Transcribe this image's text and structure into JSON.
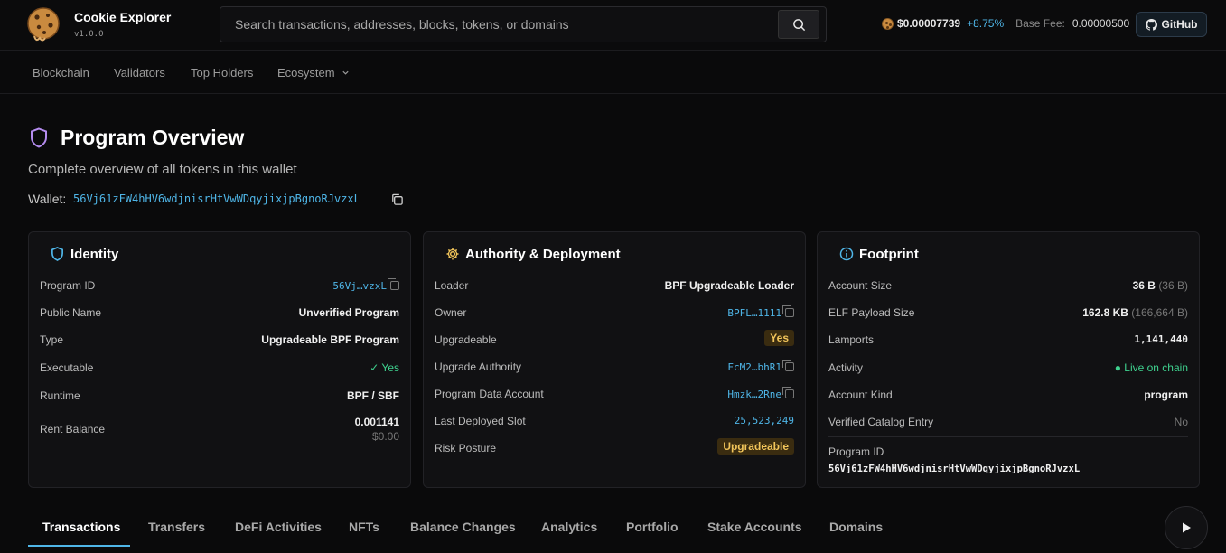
{
  "app": {
    "name": "Cookie Explorer",
    "version": "v1.0.0"
  },
  "search": {
    "placeholder": "Search transactions, addresses, blocks, tokens, or domains"
  },
  "header": {
    "price": "$0.00007739",
    "change": "+8.75%",
    "fee_label": "Base Fee:",
    "fee_value": "0.00000500",
    "github_label": "GitHub"
  },
  "nav": {
    "items": [
      "Blockchain",
      "Validators",
      "Top Holders",
      "Ecosystem"
    ]
  },
  "page": {
    "title": "Program Overview",
    "subtitle": "Complete overview of all tokens in this wallet",
    "wallet_label": "Wallet:",
    "wallet_address": "56Vj61zFW4hHV6wdjnisrHtVwWDqyjixjpBgnoRJvzxL"
  },
  "identity": {
    "title": "Identity",
    "rows": [
      {
        "label": "Program ID",
        "value": "56Vj…vzxL"
      },
      {
        "label": "Public Name",
        "value": "Unverified Program"
      },
      {
        "label": "Type",
        "value": "Upgradeable BPF Program"
      },
      {
        "label": "Executable",
        "value": "Yes"
      },
      {
        "label": "Runtime",
        "value": "BPF / SBF"
      },
      {
        "label": "Rent Balance",
        "value": "0.001141",
        "sub": "$0.00"
      }
    ]
  },
  "authority": {
    "title": "Authority & Deployment",
    "rows": [
      {
        "label": "Loader",
        "value": "BPF Upgradeable Loader"
      },
      {
        "label": "Owner",
        "value": "BPFL…1111"
      },
      {
        "label": "Upgradeable",
        "value": "Yes"
      },
      {
        "label": "Upgrade Authority",
        "value": "FcM2…bhR1"
      },
      {
        "label": "Program Data Account",
        "value": "Hmzk…2Rne"
      },
      {
        "label": "Last Deployed Slot",
        "value": "25,523,249"
      },
      {
        "label": "Risk Posture",
        "value": "Upgradeable"
      }
    ]
  },
  "footprint": {
    "title": "Footprint",
    "rows": [
      {
        "label": "Account Size",
        "value": "36 B",
        "sub": "(36 B)"
      },
      {
        "label": "ELF Payload Size",
        "value": "162.8 KB",
        "sub": "(166,664 B)"
      },
      {
        "label": "Lamports",
        "value": "1,141,440"
      },
      {
        "label": "Activity",
        "value": "Live on chain"
      },
      {
        "label": "Account Kind",
        "value": "program"
      },
      {
        "label": "Verified Catalog Entry",
        "value": "No"
      }
    ],
    "program_id_label": "Program ID",
    "program_id_value": "56Vj61zFW4hHV6wdjnisrHtVwWDqyjixjpBgnoRJvzxL"
  },
  "tabs": [
    "Transactions",
    "Transfers",
    "DeFi Activities",
    "NFTs",
    "Balance Changes",
    "Analytics",
    "Portfolio",
    "Stake Accounts",
    "Domains"
  ],
  "colors": {
    "accent": "#4fb6e8",
    "success": "#3fd28f",
    "warning": "#f2c55a",
    "purple": "#b58cf0"
  }
}
